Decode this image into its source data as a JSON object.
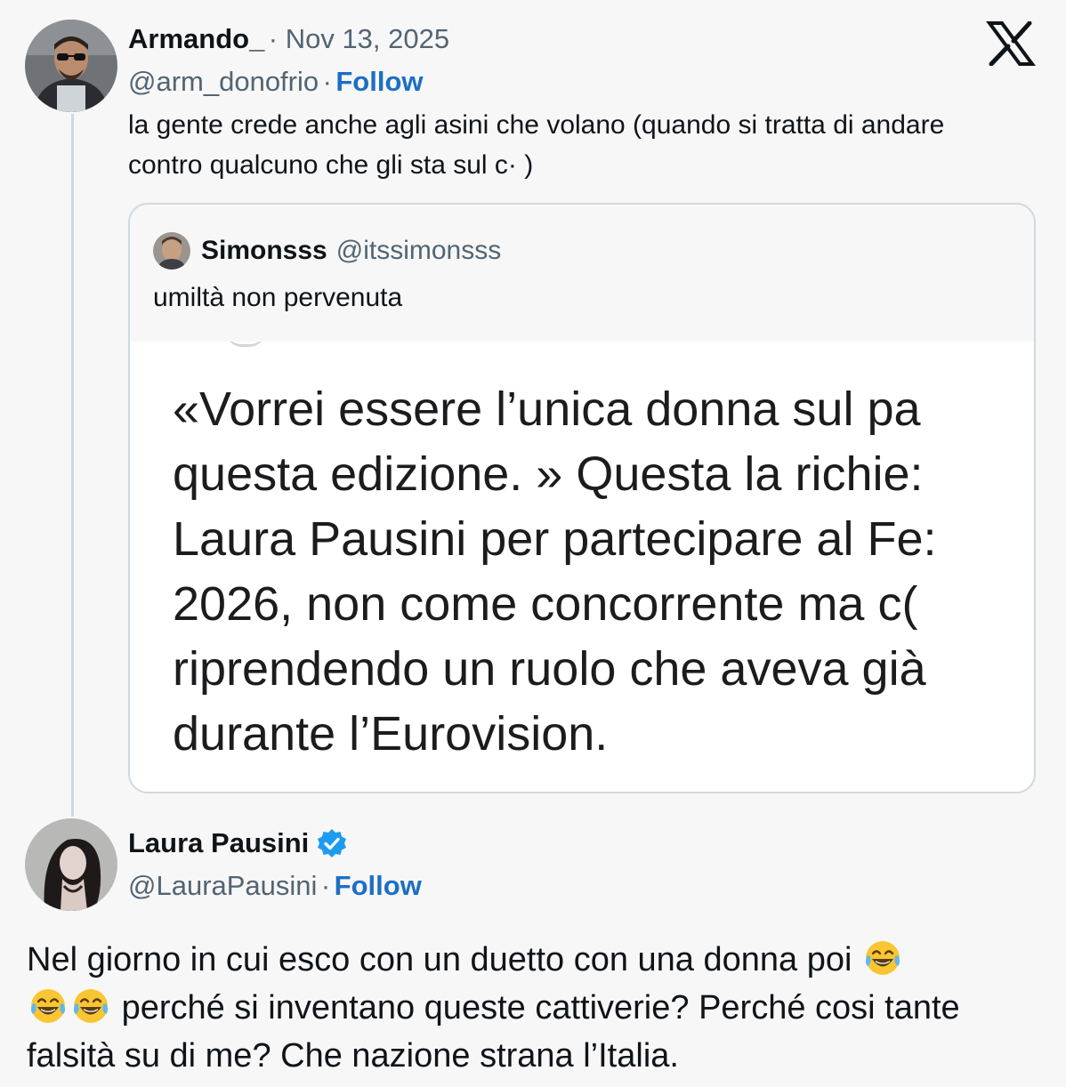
{
  "platform_logo": "x-logo",
  "tweet1": {
    "display_name": "Armando_",
    "date": "· Nov 13, 2025",
    "handle": "@arm_donofrio",
    "separator": "·",
    "follow_label": "Follow",
    "text": "la gente crede anche agli asini che volano  (quando si tratta di andare contro qualcuno che gli sta sul c·        )"
  },
  "quoted": {
    "display_name": "Simonsss",
    "handle": "@itssimonsss",
    "text": "umiltà non pervenuta",
    "media_text": "«Vorrei essere l’unica donna sul pa\nquesta edizione. » Questa la richie:\nLaura Pausini per partecipare al Fe:\n2026, non come concorrente ma c(\nriprendendo un ruolo che aveva già\ndurante l’Eurovision."
  },
  "tweet2": {
    "display_name": "Laura Pausini",
    "verified_icon": "verified-badge-icon",
    "handle": "@LauraPausini",
    "separator": "·",
    "follow_label": "Follow",
    "text_part1": "Nel giorno in cui esco con un duetto con una donna poi",
    "text_part2": "perché si inventano queste cattiverie? Perché cosi tante falsità su di me? Che nazione strana l’Italia.",
    "emoji_icon": "tears-of-joy-emoji-icon"
  },
  "colors": {
    "background": "#f7f7f8",
    "text": "#0f1419",
    "secondary": "#536471",
    "link": "#1d6fc2",
    "verified": "#1d9bf0",
    "border": "#cfd9de"
  }
}
